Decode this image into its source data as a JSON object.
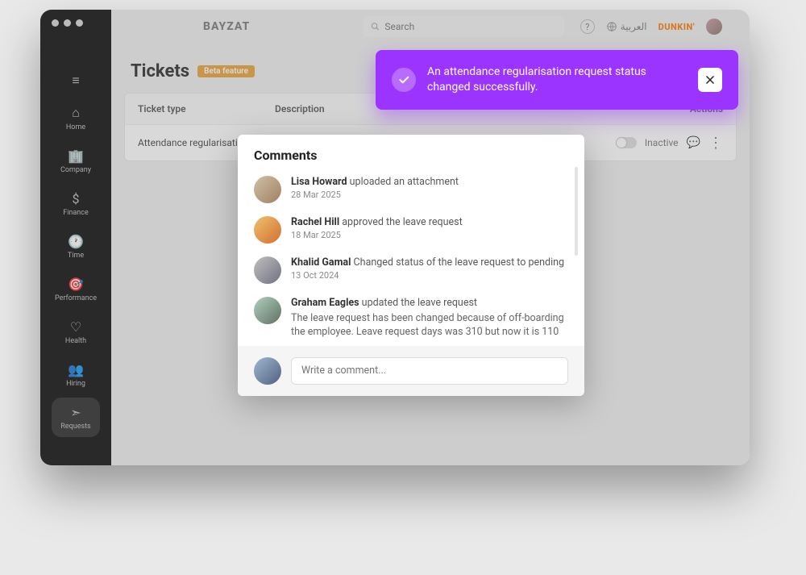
{
  "topbar": {
    "logo": "BAYZAT",
    "search_placeholder": "Search",
    "help_icon": "?",
    "language": "العربية",
    "brand": "DUNKIN'"
  },
  "sidebar": {
    "items": [
      {
        "icon": "≡",
        "label": ""
      },
      {
        "icon": "⌂",
        "label": "Home"
      },
      {
        "icon": "🏢",
        "label": "Company"
      },
      {
        "icon": "$",
        "label": "Finance"
      },
      {
        "icon": "🕐",
        "label": "Time"
      },
      {
        "icon": "🎯",
        "label": "Performance"
      },
      {
        "icon": "♡",
        "label": "Health"
      },
      {
        "icon": "👥",
        "label": "Hiring"
      },
      {
        "icon": "➣",
        "label": "Requests"
      }
    ],
    "active_index": 8
  },
  "page": {
    "title": "Tickets",
    "badge": "Beta feature"
  },
  "table": {
    "headers": {
      "type": "Ticket type",
      "desc": "Description",
      "actions": "Actions"
    },
    "rows": [
      {
        "type": "Attendance regularisation",
        "desc": "",
        "status": "Inactive"
      }
    ]
  },
  "toast": {
    "message": "An attendance regularisation request status changed successfully."
  },
  "modal": {
    "title": "Comments",
    "comments": [
      {
        "name": "Lisa Howard",
        "action": "uploaded an attachment",
        "date": "28 Mar 2025",
        "detail": ""
      },
      {
        "name": "Rachel Hill",
        "action": "approved the leave request",
        "date": "18 Mar 2025",
        "detail": ""
      },
      {
        "name": "Khalid Gamal",
        "action": "Changed status of the leave request to pending",
        "date": "13 Oct 2024",
        "detail": ""
      },
      {
        "name": "Graham Eagles",
        "action": "updated the leave request",
        "date": "",
        "detail": "The leave request has been changed because of off-boarding the employee. Leave request days was 310 but now it is 110"
      }
    ],
    "composer_placeholder": "Write a comment..."
  }
}
